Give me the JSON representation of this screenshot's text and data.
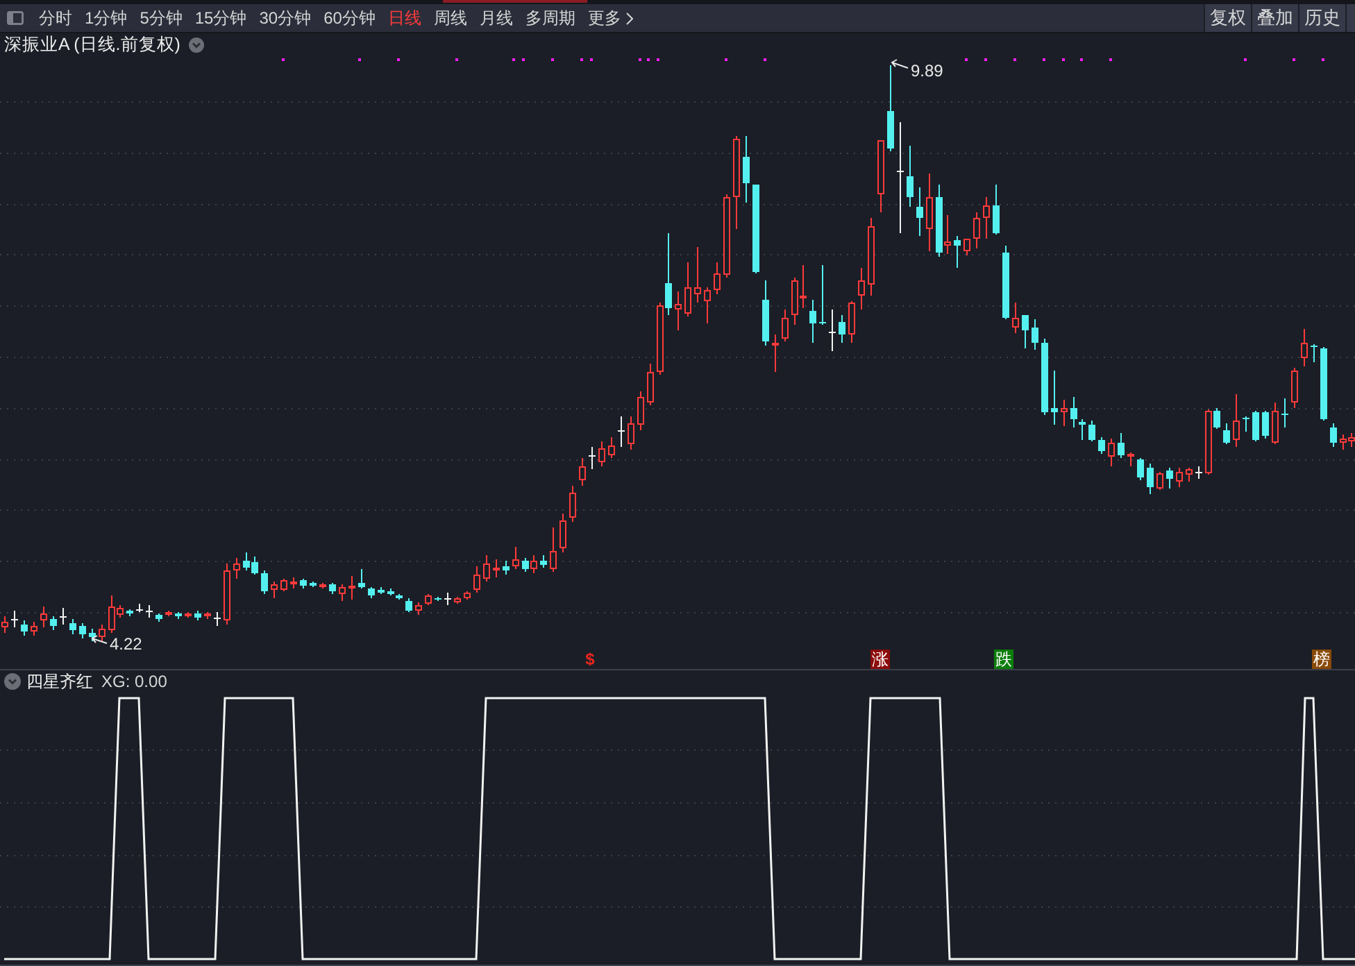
{
  "toolbar": {
    "tabs": [
      {
        "label": "分时",
        "kind": "period",
        "selected": false
      },
      {
        "label": "1分钟",
        "kind": "period",
        "selected": false
      },
      {
        "label": "5分钟",
        "kind": "period",
        "selected": false
      },
      {
        "label": "15分钟",
        "kind": "period",
        "selected": false
      },
      {
        "label": "30分钟",
        "kind": "period",
        "selected": false
      },
      {
        "label": "60分钟",
        "kind": "period",
        "selected": false
      },
      {
        "label": "日线",
        "kind": "period",
        "selected": true
      },
      {
        "label": "周线",
        "kind": "period",
        "selected": false
      },
      {
        "label": "月线",
        "kind": "period",
        "selected": false
      },
      {
        "label": "多周期",
        "kind": "period",
        "selected": false
      },
      {
        "label": "更多",
        "kind": "menu",
        "selected": false
      }
    ],
    "buttons": [
      "复权",
      "叠加",
      "历史"
    ]
  },
  "chart": {
    "title": "深振业A (日线.前复权)",
    "high_label": "9.89",
    "low_label": "4.22",
    "event_markers": [
      {
        "label": "$",
        "kind": "symbol",
        "color": "#e8251e"
      },
      {
        "label": "涨",
        "kind": "tag",
        "color": "#8c0c0c"
      },
      {
        "label": "跌",
        "kind": "tag",
        "color": "#0b7d0b"
      },
      {
        "label": "榜",
        "kind": "tag",
        "color": "#8a4a08"
      }
    ]
  },
  "indicator": {
    "name": "四星齐红",
    "reading": "XG: 0.00"
  }
}
